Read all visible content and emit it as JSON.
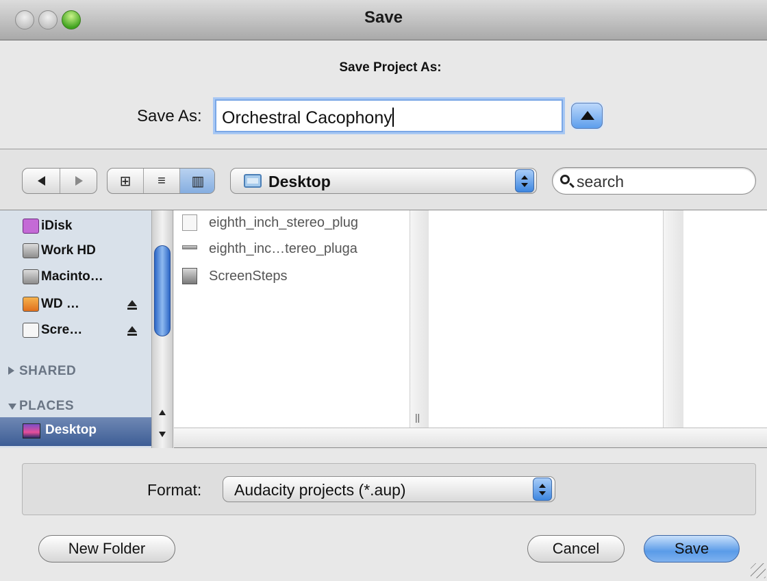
{
  "window": {
    "title": "Save",
    "dialog_heading": "Save Project As:"
  },
  "save_as": {
    "label": "Save As:",
    "value": "Orchestral Cacophony"
  },
  "toolbar": {
    "back_icon": "back-arrow-icon",
    "forward_icon": "forward-arrow-icon",
    "views": [
      {
        "name": "icon-view",
        "glyph": "⊞"
      },
      {
        "name": "list-view",
        "glyph": "≡"
      },
      {
        "name": "column-view",
        "glyph": "▥",
        "selected": true
      }
    ],
    "location": "Desktop",
    "search_placeholder": "search"
  },
  "sidebar": {
    "devices": [
      {
        "label": "iDisk",
        "icon": "idisk-icon",
        "eject": false
      },
      {
        "label": "Work HD",
        "icon": "hard-drive-icon",
        "eject": false
      },
      {
        "label": "Macinto…",
        "icon": "hard-drive-icon",
        "eject": false
      },
      {
        "label": "WD …",
        "icon": "external-drive-icon",
        "eject": true
      },
      {
        "label": "Scre…",
        "icon": "disk-image-icon",
        "eject": true
      }
    ],
    "sections": {
      "shared": "SHARED",
      "places": "PLACES"
    },
    "selected_place": "Desktop"
  },
  "files": [
    {
      "name": "eighth_inch_stereo_plug",
      "icon": "document-icon"
    },
    {
      "name": "eighth_inc…tereo_pluga",
      "icon": "file-icon"
    },
    {
      "name": "ScreenSteps",
      "icon": "app-icon"
    }
  ],
  "format": {
    "label": "Format:",
    "value": "Audacity projects (*.aup)"
  },
  "buttons": {
    "new_folder": "New Folder",
    "cancel": "Cancel",
    "save": "Save"
  },
  "colors": {
    "selection": "#4f6fa6",
    "accent": "#5a9be8",
    "sidebar_bg": "#d9e1ea"
  }
}
